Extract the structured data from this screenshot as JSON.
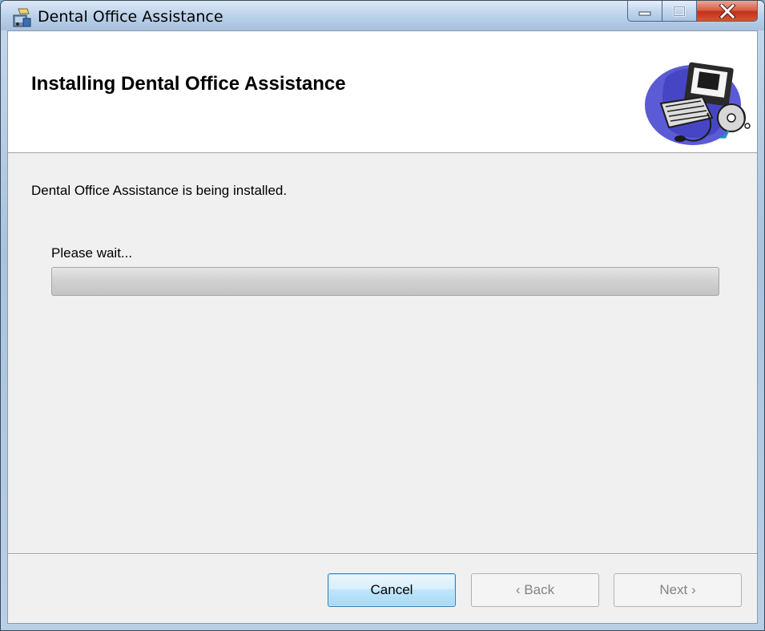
{
  "window": {
    "title": "Dental Office Assistance"
  },
  "banner": {
    "title": "Installing Dental Office Assistance"
  },
  "main": {
    "status": "Dental Office Assistance is being installed.",
    "wait_label": "Please wait...",
    "progress_fraction": 0.0
  },
  "buttons": {
    "cancel": "Cancel",
    "back": "‹ Back",
    "next": "Next ›"
  },
  "colors": {
    "close_button": "#c2321c",
    "cancel_focus_border": "#3c7fb1",
    "client_background": "#f0f0f0"
  }
}
